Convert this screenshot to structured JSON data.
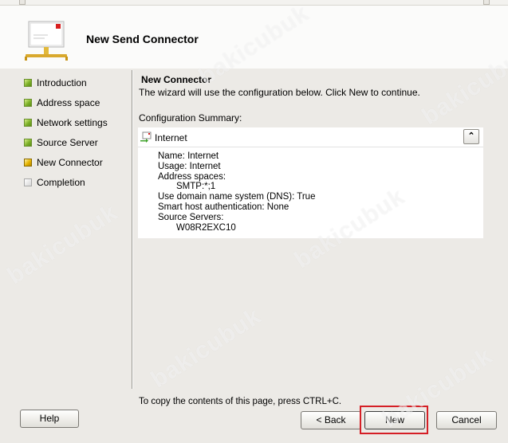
{
  "window": {
    "title": "New Send Connector"
  },
  "nav": {
    "items": [
      {
        "label": "Introduction",
        "state": "done"
      },
      {
        "label": "Address space",
        "state": "done"
      },
      {
        "label": "Network settings",
        "state": "done"
      },
      {
        "label": "Source Server",
        "state": "done"
      },
      {
        "label": "New Connector",
        "state": "current"
      },
      {
        "label": "Completion",
        "state": "pending"
      }
    ]
  },
  "page": {
    "heading": "New Connector",
    "description": "The wizard will use the configuration below.  Click New to continue.",
    "summary_label": "Configuration Summary:",
    "copy_hint": "To copy the contents of this page, press CTRL+C."
  },
  "summary": {
    "title": "Internet",
    "collapse_icon": "double-chevron-up-icon",
    "lines": [
      {
        "text": "Name: Internet",
        "indent": false
      },
      {
        "text": "Usage: Internet",
        "indent": false
      },
      {
        "text": "Address spaces:",
        "indent": false
      },
      {
        "text": "SMTP:*;1",
        "indent": true
      },
      {
        "text": "Use domain name system (DNS): True",
        "indent": false
      },
      {
        "text": "Smart host authentication: None",
        "indent": false
      },
      {
        "text": "Source Servers:",
        "indent": false
      },
      {
        "text": "W08R2EXC10",
        "indent": true
      }
    ]
  },
  "buttons": {
    "help": "Help",
    "back": "< Back",
    "new": "New",
    "cancel": "Cancel"
  },
  "watermark": "bakicubuk",
  "colors": {
    "highlight": "#d51f26",
    "step_done": "#7fb22a",
    "step_current": "#e6b400",
    "step_pending": "#d6d6d6"
  }
}
